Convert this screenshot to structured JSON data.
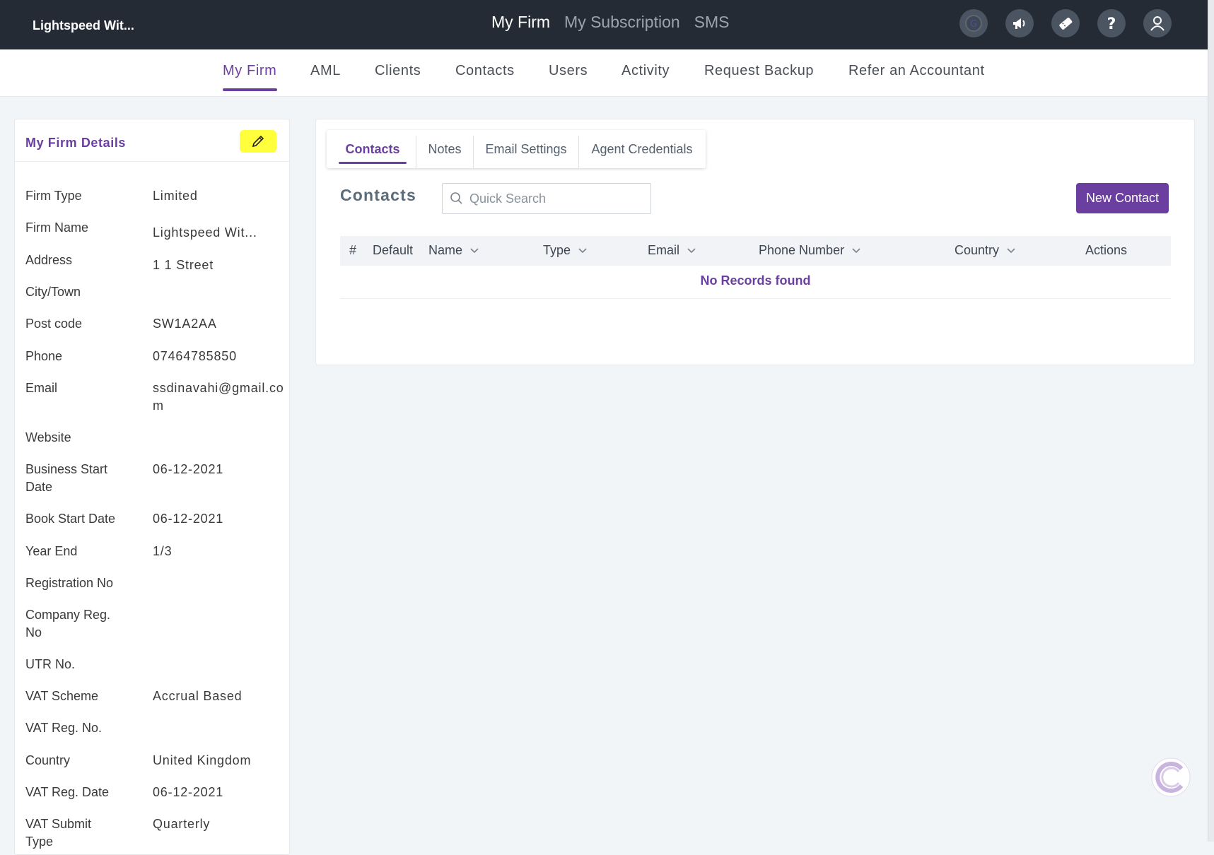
{
  "app": {
    "firm_short": "Lightspeed Wit...",
    "top_nav": [
      "My Firm",
      "My Subscription",
      "SMS"
    ],
    "top_icons": [
      "profile-circle-icon",
      "megaphone-icon",
      "ticket-icon",
      "help-icon",
      "user-icon"
    ]
  },
  "subnav": {
    "items": [
      "My Firm",
      "AML",
      "Clients",
      "Contacts",
      "Users",
      "Activity",
      "Request Backup",
      "Refer an Accountant"
    ],
    "active": "My Firm"
  },
  "firm_details": {
    "title": "My Firm Details",
    "fields": [
      {
        "label": "Firm Type",
        "value": "Limited"
      },
      {
        "label": "Firm Name",
        "value": "Lightspeed Wit..."
      },
      {
        "label": "Address",
        "value": "1 1 Street"
      },
      {
        "label": "City/Town",
        "value": ""
      },
      {
        "label": "Post code",
        "value": "SW1A2AA"
      },
      {
        "label": "Phone",
        "value": "07464785850"
      },
      {
        "label": "Email",
        "value": "ssdinavahi@gmail.com"
      },
      {
        "label": "Website",
        "value": ""
      },
      {
        "label": "Business Start Date",
        "value": "06-12-2021"
      },
      {
        "label": "Book Start Date",
        "value": "06-12-2021"
      },
      {
        "label": "Year End",
        "value": "1/3"
      },
      {
        "label": "Registration No",
        "value": ""
      },
      {
        "label": "Company Reg. No",
        "value": ""
      },
      {
        "label": "UTR No.",
        "value": ""
      },
      {
        "label": "VAT Scheme",
        "value": "Accrual Based"
      },
      {
        "label": "VAT Reg. No.",
        "value": ""
      },
      {
        "label": "Country",
        "value": "United Kingdom"
      },
      {
        "label": "VAT Reg. Date",
        "value": "06-12-2021"
      },
      {
        "label": "VAT Submit Type",
        "value": "Quarterly"
      }
    ]
  },
  "main": {
    "tabs": [
      "Contacts",
      "Notes",
      "Email Settings",
      "Agent Credentials"
    ],
    "active_tab": "Contacts",
    "section_title": "Contacts",
    "search_placeholder": "Quick Search",
    "new_button": "New Contact",
    "columns": [
      "#",
      "Default",
      "Name",
      "Type",
      "Email",
      "Phone Number",
      "Country",
      "Actions"
    ],
    "empty_message": "No Records found"
  },
  "colors": {
    "brand": "#6b3fa0",
    "topbar": "#252b35",
    "highlight": "#ffff3c"
  }
}
